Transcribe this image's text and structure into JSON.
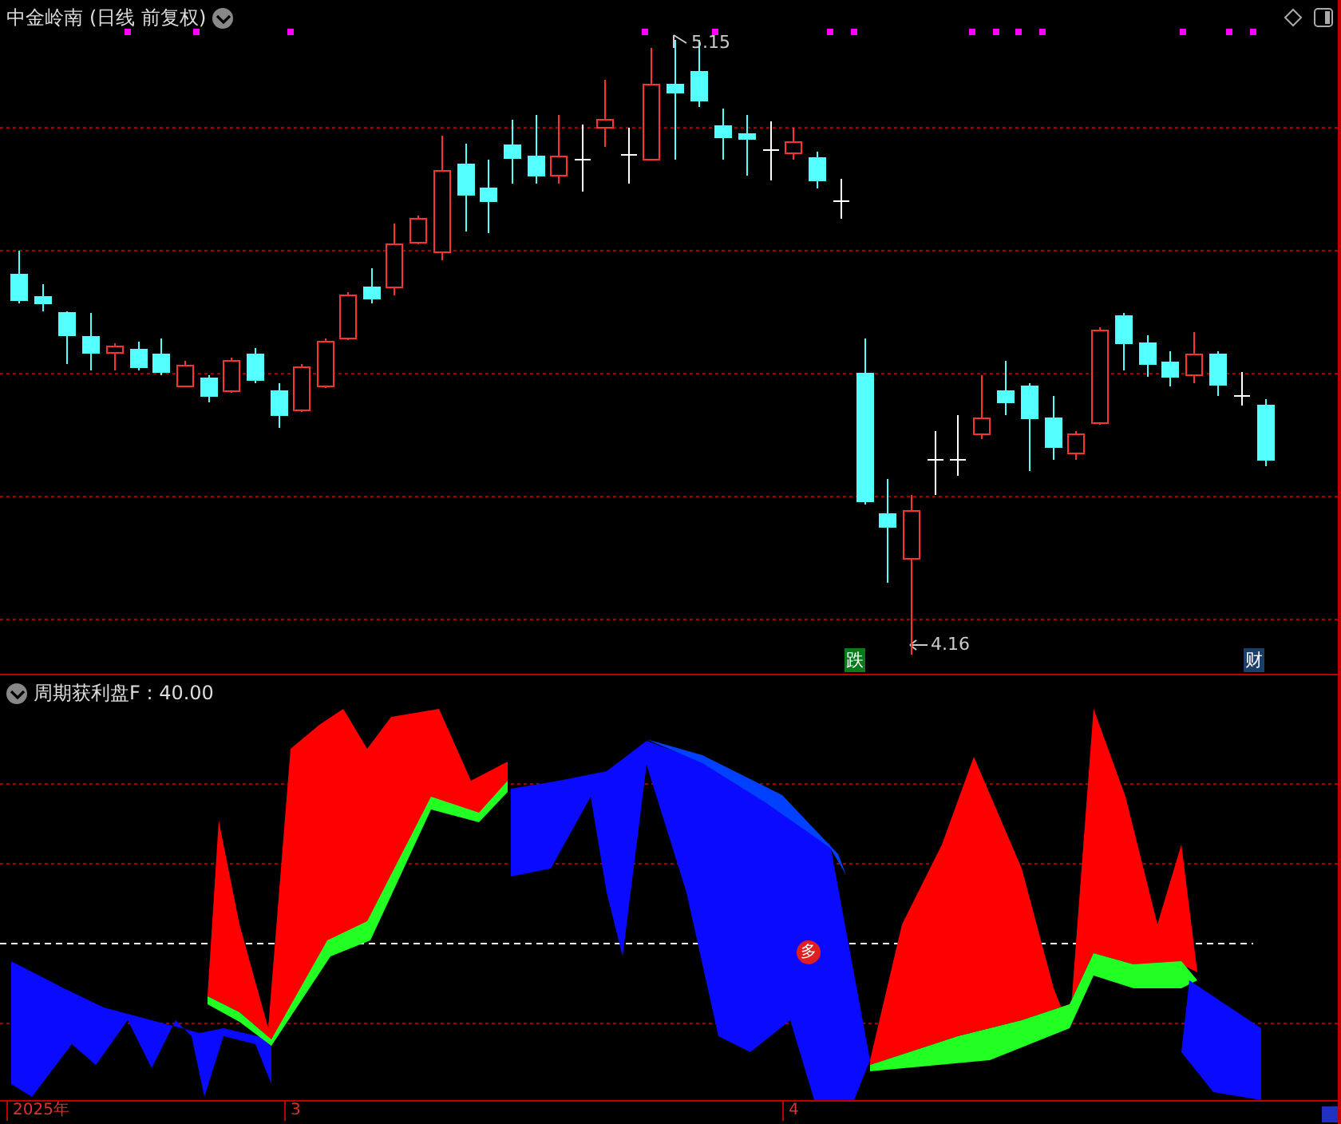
{
  "chart_header": {
    "stock_name": "中金岭南",
    "period": "(日线 前复权)"
  },
  "price_panel": {
    "high_label": "5.15",
    "low_label": "4.16",
    "badges": [
      {
        "text": "跌",
        "color": "#0a7a1a"
      },
      {
        "text": "财",
        "color": "#1a3f6a"
      }
    ]
  },
  "indicator_panel": {
    "title": "周期获利盘F : 40.00",
    "signal_marker": "多"
  },
  "time_axis": [
    "2025年",
    "3",
    "4"
  ]
}
